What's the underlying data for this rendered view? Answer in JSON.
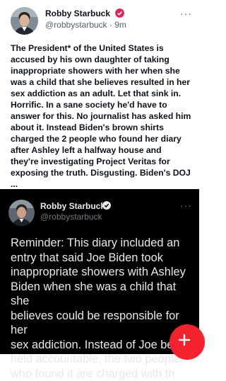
{
  "colors": {
    "verified": "#e0245e",
    "verified_dark": "#f4212e",
    "fab": "#f4212e"
  },
  "tweet1": {
    "author": "Robby Starbuck",
    "handle": "@robbystarbuck · 9m",
    "more": "···",
    "lines": [
      "The President* of the United States is",
      "accused by his own daughter of taking",
      "inappropriate showers with her when she",
      "was a child that she believes resulted in her",
      "sex addiction as an adult. Let that sink in.",
      "Horrific. In a sane society he'd have to",
      "answer for this. No journalist has asked him",
      "about it. Instead Biden's brown shirts",
      "charged the 2 people who found her diary",
      "after Ashley left a halfway house and",
      "they're investigating Project Veritas for",
      "exposing the truth. Disgusting. Biden's DOJ",
      "..."
    ]
  },
  "tweet2": {
    "author": "Robby Starbuck",
    "handle": "@robbystarbuck",
    "more": "···",
    "lines": [
      "Reminder: This diary included an",
      "entry that said Joe Biden took",
      "inappropriate showers with Ashley",
      "Biden when she was a child that she",
      "believes could be responsible for her",
      "sex addiction. Instead of Joe being",
      "held accountable, the two people",
      "who found it are charged with th"
    ]
  },
  "fab": {
    "label": "+"
  }
}
